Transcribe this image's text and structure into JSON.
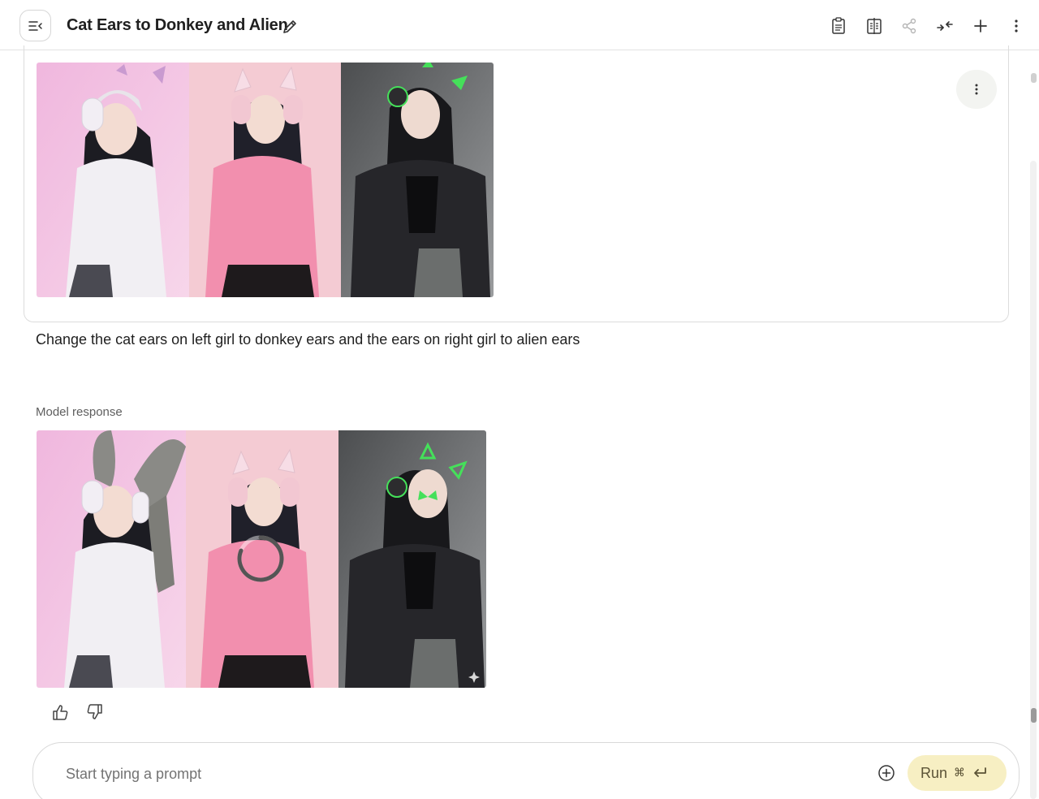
{
  "header": {
    "title": "Cat Ears to Donkey and Alien",
    "icons": [
      "menu-collapse-icon",
      "edit-icon",
      "clipboard-icon",
      "compare-icon",
      "share-icon",
      "collapse-icon",
      "plus-icon",
      "more-vert-icon"
    ]
  },
  "prompt": {
    "text": "Change the cat ears on left girl to donkey ears and the ears on right girl to alien ears"
  },
  "response": {
    "label": "Model response"
  },
  "input": {
    "placeholder": "Start typing a prompt",
    "run_label": "Run",
    "run_shortcut": "⌘"
  },
  "colors": {
    "run_bg": "#f7efc3",
    "border": "#dcdcdc",
    "panel_pink_light": "#f2c9e0",
    "panel_pink": "#f5c9d2",
    "panel_gray": "#6d6f70",
    "neon_green": "#45e05a"
  }
}
